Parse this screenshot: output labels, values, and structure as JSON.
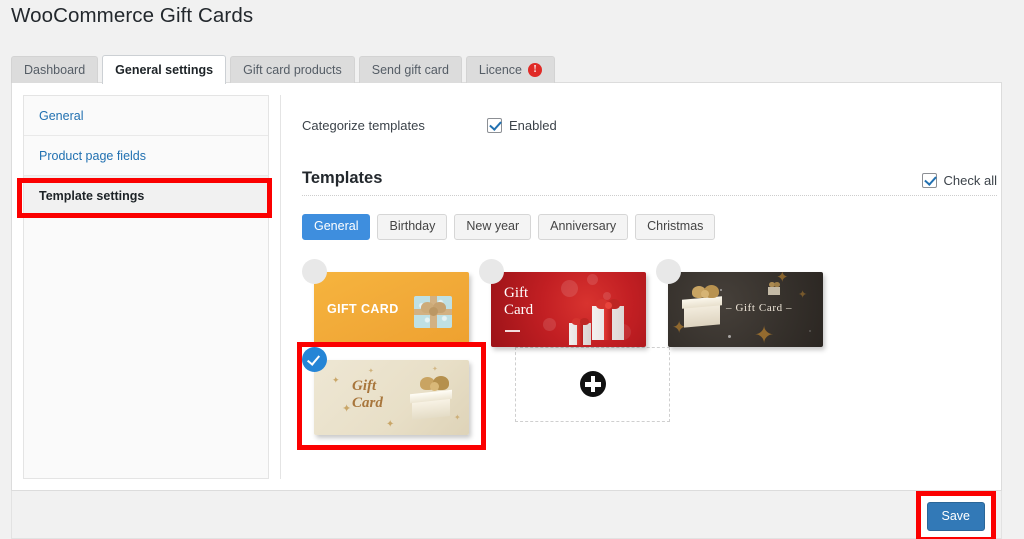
{
  "header": {
    "title": "WooCommerce Gift Cards"
  },
  "tabs": [
    {
      "label": "Dashboard",
      "active": false,
      "badge": null
    },
    {
      "label": "General settings",
      "active": true,
      "badge": null
    },
    {
      "label": "Gift card products",
      "active": false,
      "badge": null
    },
    {
      "label": "Send gift card",
      "active": false,
      "badge": null
    },
    {
      "label": "Licence",
      "active": false,
      "badge": "!"
    }
  ],
  "sidebar": {
    "items": [
      {
        "label": "General",
        "current": false
      },
      {
        "label": "Product page fields",
        "current": false
      },
      {
        "label": "Template settings",
        "current": true
      }
    ]
  },
  "settings": {
    "categorize": {
      "label": "Categorize templates",
      "checkbox_label": "Enabled",
      "checked": true
    }
  },
  "templates_section": {
    "title": "Templates",
    "check_all": {
      "label": "Check all",
      "checked": true
    },
    "categories": [
      {
        "label": "General",
        "active": true
      },
      {
        "label": "Birthday",
        "active": false
      },
      {
        "label": "New year",
        "active": false
      },
      {
        "label": "Anniversary",
        "active": false
      },
      {
        "label": "Christmas",
        "active": false
      }
    ],
    "templates": [
      {
        "name": "amber-gift-card",
        "text": "GIFT CARD",
        "selected": false,
        "highlighted": false
      },
      {
        "name": "red-gift-card",
        "text_line1": "Gift",
        "text_line2": "Card",
        "selected": false,
        "highlighted": false
      },
      {
        "name": "dark-gold-gift-card",
        "text": "– Gift Card –",
        "selected": false,
        "highlighted": false
      },
      {
        "name": "cream-gold-gift-card",
        "text_line1": "Gift",
        "text_line2": "Card",
        "selected": true,
        "highlighted": true
      }
    ],
    "add_new": {
      "icon": "plus-circle-icon"
    }
  },
  "footer": {
    "save_label": "Save"
  },
  "colors": {
    "accent_blue": "#3e8ede",
    "selected_blue": "#2585d6",
    "save_blue": "#3279b7",
    "annotation_red": "#fb0000",
    "alert_red": "#e02b27",
    "link_blue": "#2271b1",
    "page_bg": "#f1f1f1"
  }
}
